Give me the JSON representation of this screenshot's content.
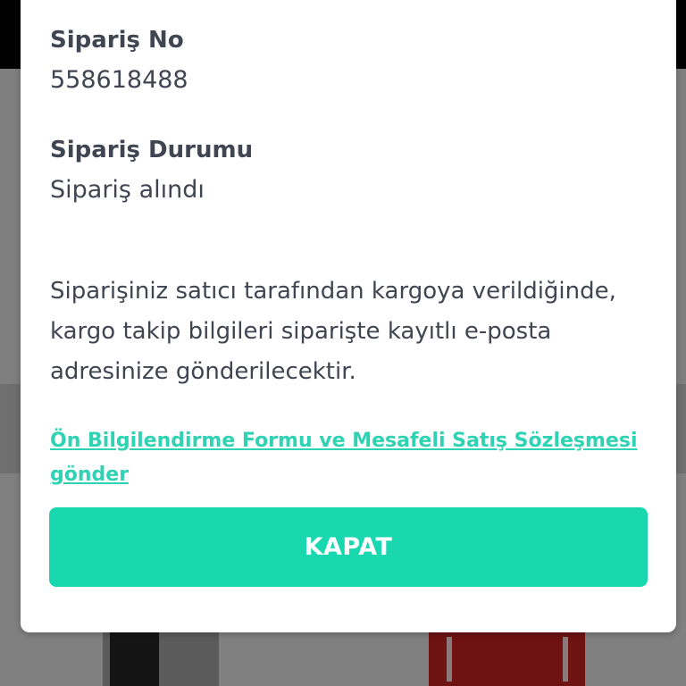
{
  "order": {
    "number_label": "Sipariş No",
    "number_value": "558618488",
    "status_label": "Sipariş Durumu",
    "status_value": "Sipariş alındı"
  },
  "info_text": "Siparişiniz satıcı tarafından kargoya verildiğinde, kargo takip bilgileri siparişte kayıtlı e-posta adresinize gönderilecektir.",
  "link_text": "Ön Bilgilendirme Formu ve Mesafeli Satış Sözleşmesi gönder",
  "close_button_label": "KAPAT",
  "colors": {
    "accent": "#19d8b0",
    "link": "#2fd3b3",
    "text": "#3f4551"
  }
}
